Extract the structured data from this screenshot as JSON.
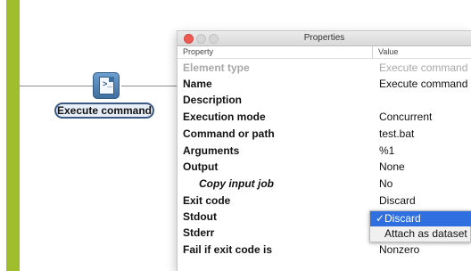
{
  "canvas": {
    "node_label": "Execute command",
    "node_icon": "terminal-script-icon",
    "accent_color": "#9fbd2c"
  },
  "window": {
    "title": "Properties",
    "columns": {
      "property": "Property",
      "value": "Value"
    },
    "rows": [
      {
        "property": "Element type",
        "value": "Execute command"
      },
      {
        "property": "Name",
        "value": "Execute command"
      },
      {
        "property": "Description",
        "value": ""
      },
      {
        "property": "Execution mode",
        "value": "Concurrent"
      },
      {
        "property": "Command or path",
        "value": "test.bat"
      },
      {
        "property": "Arguments",
        "value": "%1"
      },
      {
        "property": "Output",
        "value": "None"
      },
      {
        "property": "Copy input job",
        "value": "No"
      },
      {
        "property": "Exit code",
        "value": "Discard"
      },
      {
        "property": "Stdout",
        "value": ""
      },
      {
        "property": "Stderr",
        "value": ""
      },
      {
        "property": "Fail if exit code is",
        "value": "Nonzero"
      }
    ]
  },
  "dropdown": {
    "checkmark": "✓",
    "options": [
      "Discard",
      "Attach as dataset"
    ]
  }
}
